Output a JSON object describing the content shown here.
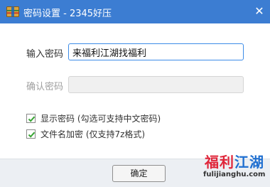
{
  "window": {
    "title": "密码设置 - 2345好压",
    "close_symbol": "✕",
    "app_icon": "archive-icon"
  },
  "form": {
    "password_label": "输入密码",
    "password_value": "来福利江湖找福利",
    "confirm_label": "确认密码",
    "confirm_value": ""
  },
  "options": [
    {
      "label": "显示密码 (勾选可支持中文密码)",
      "checked": true
    },
    {
      "label": "文件名加密 (仅支持7z格式)",
      "checked": true
    }
  ],
  "footer": {
    "ok_label": "确定"
  },
  "watermark": {
    "brand_part1": "福利",
    "brand_part2": "江湖",
    "url": "fulijianghu.com"
  },
  "colors": {
    "titlebar": "#3c7dd2",
    "check_green": "#3aa535",
    "brand_red": "#e0263a",
    "brand_blue": "#1f6fd0"
  }
}
